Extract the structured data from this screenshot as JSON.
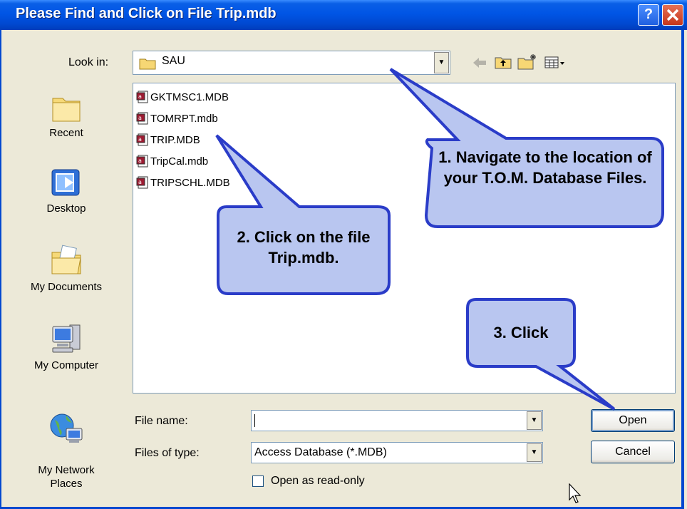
{
  "window": {
    "title": "Please Find and Click on File Trip.mdb",
    "help_label": "?",
    "close_label": "✕",
    "colors": {
      "titlebar": "#0055E5",
      "face": "#ECE9D8",
      "callout_fill": "#B9C6F0",
      "callout_border": "#2A3CC8"
    }
  },
  "toolbar": {
    "look_in_label": "Look in:",
    "look_in_value": "SAU",
    "icons": [
      "back-arrow-icon",
      "up-one-level-icon",
      "new-folder-icon",
      "views-menu-icon"
    ]
  },
  "places": [
    {
      "label": "Recent",
      "icon": "recent-folder-icon"
    },
    {
      "label": "Desktop",
      "icon": "desktop-icon"
    },
    {
      "label": "My Documents",
      "icon": "my-documents-icon"
    },
    {
      "label": "My Computer",
      "icon": "my-computer-icon"
    },
    {
      "label": "My Network\nPlaces",
      "icon": "network-places-icon"
    }
  ],
  "files": [
    {
      "name": "GKTMSC1.MDB"
    },
    {
      "name": "TOMRPT.mdb"
    },
    {
      "name": "TRIP.MDB"
    },
    {
      "name": "TripCal.mdb"
    },
    {
      "name": "TRIPSCHL.MDB"
    }
  ],
  "form": {
    "filename_label": "File name:",
    "filename_value": "",
    "filetype_label": "Files of type:",
    "filetype_value": "Access Database (*.MDB)",
    "readonly_label": "Open as read-only",
    "readonly_checked": false
  },
  "buttons": {
    "open": "Open",
    "cancel": "Cancel"
  },
  "callouts": [
    {
      "text": "1. Navigate to the location of your T.O.M. Database Files."
    },
    {
      "text": "2. Click on the file Trip.mdb."
    },
    {
      "text": "3. Click"
    }
  ]
}
